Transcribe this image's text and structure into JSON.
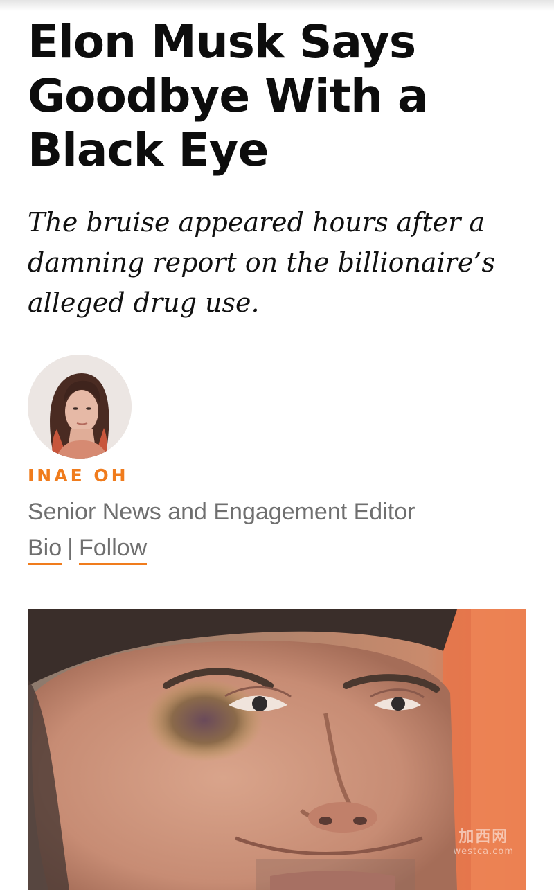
{
  "article": {
    "headline": "Elon Musk Says Goodbye With a Black Eye",
    "dek": "The bruise appeared hours after a damning report on the billionaire’s alleged drug use."
  },
  "author": {
    "name": "INAE OH",
    "title": "Senior News and Engagement Editor",
    "bio_label": "Bio",
    "separator": "|",
    "follow_label": "Follow"
  },
  "hero_image": {
    "watermark_text": "加西网",
    "watermark_domain": "westca.com"
  },
  "colors": {
    "accent": "#f07c1d",
    "muted_text": "#6f6f6f",
    "headline_text": "#0d0d0d"
  }
}
